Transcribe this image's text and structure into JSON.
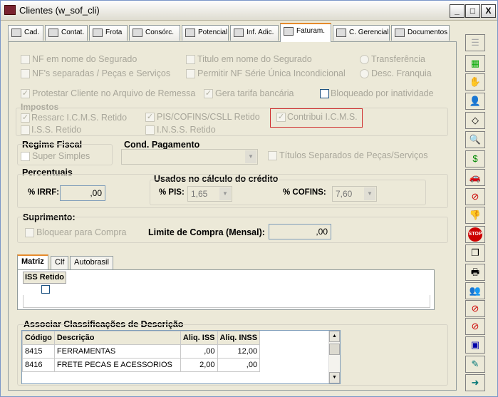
{
  "window": {
    "title": "Clientes (w_sof_cli)",
    "min": "_",
    "max": "□",
    "close": "X"
  },
  "tabs": [
    {
      "label": "Cad."
    },
    {
      "label": "Contat."
    },
    {
      "label": "Frota"
    },
    {
      "label": "Consórc."
    },
    {
      "label": "Potencial"
    },
    {
      "label": "Inf. Adic."
    },
    {
      "label": "Faturam."
    },
    {
      "label": "C. Gerencial"
    },
    {
      "label": "Documentos"
    }
  ],
  "faturamento": {
    "nf_segurado": "NF em nome do Segurado",
    "titulo_segurado": "Titulo em nome do Segurado",
    "transferencia": "Transferência",
    "nf_separadas": "NF's separadas / Peças e Serviços",
    "nf_serie_unica": "Permitir NF Série Única Incondicional",
    "desc_franquia": "Desc. Franquia",
    "protestar": "Protestar Cliente no Arquivo de Remessa",
    "gera_tarifa": "Gera tarifa bancária",
    "bloqueado": "Bloqueado por inatividade",
    "impostos_title": "Impostos",
    "ressarc": "Ressarc I.C.M.S. Retido",
    "pis_cofins": "PIS/COFINS/CSLL Retido",
    "contribui": "Contribui I.C.M.S.",
    "iss_retido": "I.S.S. Retido",
    "inss_retido": "I.N.S.S. Retido",
    "regime_title": "Regime Fiscal",
    "super_simples": "Super Simples",
    "cond_pagamento": "Cond. Pagamento",
    "titulos_separados": "Títulos Separados de Peças/Serviços",
    "percentuais_title": "Percentuais",
    "irrf_label": "% IRRF:",
    "irrf_value": ",00",
    "usados_title": "Usados no cálculo do crédito",
    "pis_label": "% PIS:",
    "pis_value": "1,65",
    "cofins_label": "% COFINS:",
    "cofins_value": "7,60",
    "suprimento_title": "Suprimento:",
    "bloquear_compra": "Bloquear para Compra",
    "limite_label": "Limite de Compra (Mensal):",
    "limite_value": ",00"
  },
  "subtabs": [
    {
      "label": "Matriz"
    },
    {
      "label": "Clf"
    },
    {
      "label": "Autobrasil"
    }
  ],
  "iss_header": "ISS Retido",
  "assoc": {
    "title": "Associar Classificações de Descrição",
    "columns": [
      "Código",
      "Descrição",
      "Aliq. ISS",
      "Aliq. INSS"
    ],
    "rows": [
      [
        "8415",
        "FERRAMENTAS",
        ",00",
        "12,00"
      ],
      [
        "8416",
        "FRETE PECAS E ACESSORIOS",
        "2,00",
        ",00"
      ]
    ]
  },
  "sidebar_icons": [
    "list-icon",
    "grid-icon",
    "hand-icon",
    "user-icon",
    "eraser-icon",
    "search-doc-icon",
    "money-icon",
    "car-icon",
    "block-icon",
    "thumb-down-icon",
    "stop-icon",
    "copy-icon",
    "print-icon",
    "group-icon",
    "doc-block-icon",
    "doc-block-icon",
    "cards-icon",
    "edit-icon",
    "exit-icon"
  ]
}
